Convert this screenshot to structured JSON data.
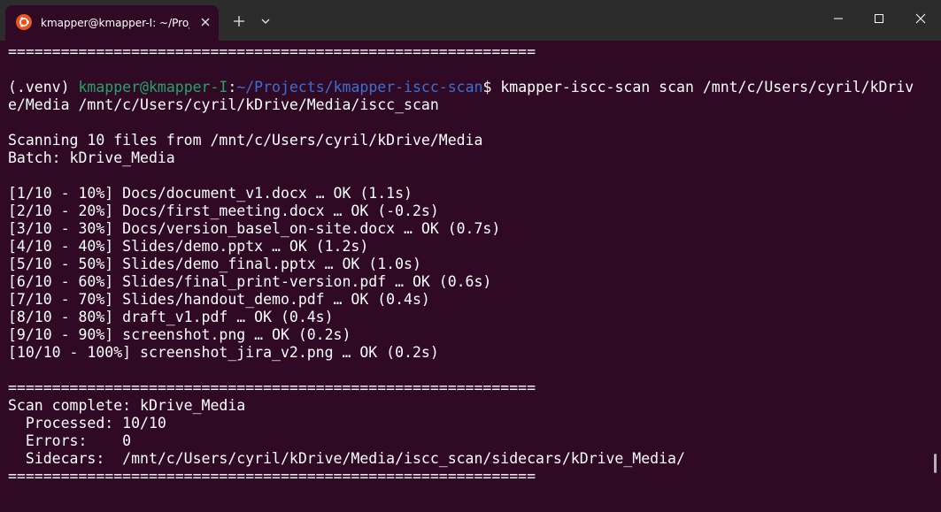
{
  "window": {
    "tab_title": "kmapper@kmapper-I: ~/Projects/kmapper-iscc-scan"
  },
  "colors": {
    "background": "#300a24",
    "titlebar": "#2c2c2c",
    "text": "#ffffff",
    "prompt_user": "#26a269",
    "prompt_path": "#3c6fd0",
    "ubuntu_icon": "#e95420"
  },
  "icons": {
    "tab": "ubuntu-icon",
    "tab_close": "close-icon",
    "new_tab": "plus-icon",
    "tab_dropdown": "chevron-down-icon",
    "minimize": "minimize-icon",
    "maximize": "maximize-icon",
    "close": "close-icon"
  },
  "terminal": {
    "separator_top": "============================================================",
    "blank_1": "",
    "prompt": {
      "venv": "(.venv) ",
      "user": "kmapper@kmapper-I",
      "colon": ":",
      "path": "~/Projects/kmapper-iscc-scan",
      "symbol": "$ ",
      "command_part1": "kmapper-iscc-scan scan /mnt/c/Users/cyril/kDriv",
      "command_part2": "e/Media /mnt/c/Users/cyril/kDrive/Media/iscc_scan"
    },
    "blank_2": "",
    "scanning": "Scanning 10 files from /mnt/c/Users/cyril/kDrive/Media",
    "batch": "Batch: kDrive_Media",
    "blank_3": "",
    "progress": [
      "[1/10 - 10%] Docs/document_v1.docx … OK (1.1s)",
      "[2/10 - 20%] Docs/first_meeting.docx … OK (-0.2s)",
      "[3/10 - 30%] Docs/version_basel_on-site.docx … OK (0.7s)",
      "[4/10 - 40%] Slides/demo.pptx … OK (1.2s)",
      "[5/10 - 50%] Slides/demo_final.pptx … OK (1.0s)",
      "[6/10 - 60%] Slides/final_print-version.pdf … OK (0.6s)",
      "[7/10 - 70%] Slides/handout_demo.pdf … OK (0.4s)",
      "[8/10 - 80%] draft_v1.pdf … OK (0.4s)",
      "[9/10 - 90%] screenshot.png … OK (0.2s)",
      "[10/10 - 100%] screenshot_jira_v2.png … OK (0.2s)"
    ],
    "blank_4": "",
    "separator_mid": "============================================================",
    "complete": "Scan complete: kDrive_Media",
    "processed": "  Processed: 10/10",
    "errors": "  Errors:    0",
    "sidecars": "  Sidecars:  /mnt/c/Users/cyril/kDrive/Media/iscc_scan/sidecars/kDrive_Media/",
    "separator_bottom": "============================================================"
  }
}
